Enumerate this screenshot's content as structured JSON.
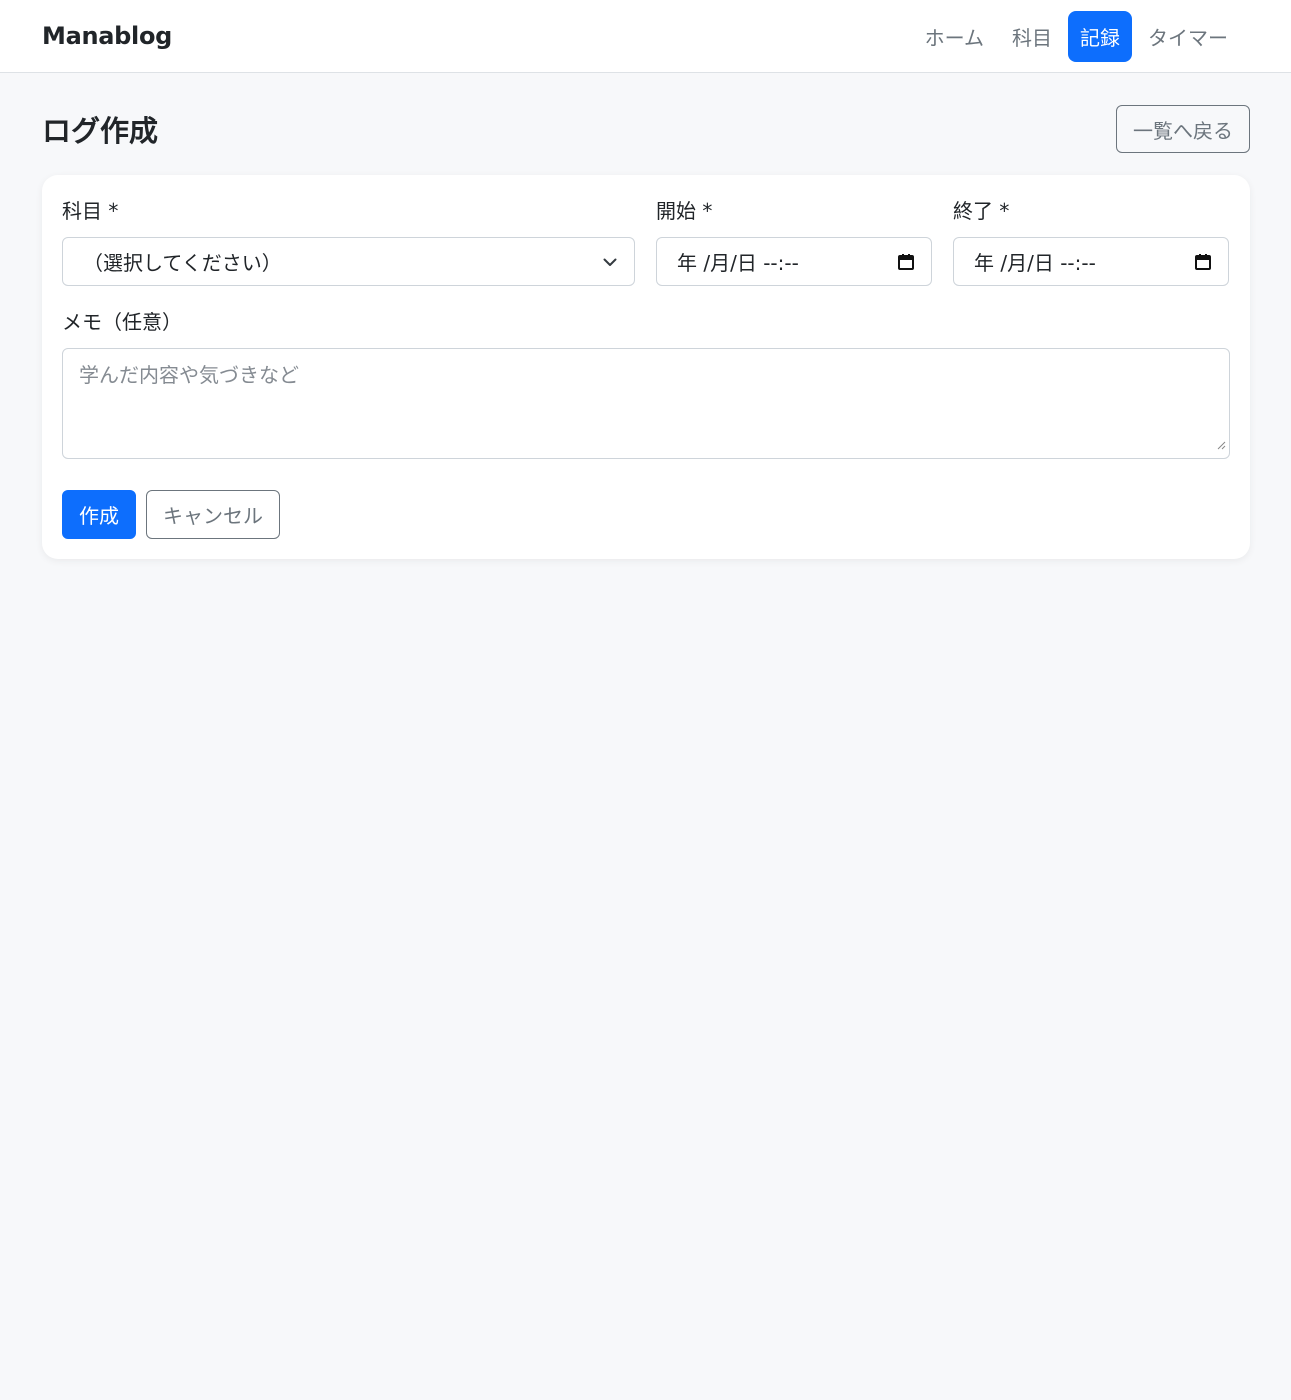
{
  "app": {
    "brand": "Manablog"
  },
  "nav": {
    "items": [
      {
        "label": "ホーム",
        "active": false
      },
      {
        "label": "科目",
        "active": false
      },
      {
        "label": "記録",
        "active": true
      },
      {
        "label": "タイマー",
        "active": false
      }
    ]
  },
  "page": {
    "title": "ログ作成",
    "back_label": "一覧へ戻る"
  },
  "form": {
    "subject": {
      "label": "科目 *",
      "value": "（選択してください）",
      "icon": "chevron-down-icon"
    },
    "start": {
      "label": "開始 *",
      "value": "年 /月/日 --:--",
      "icon": "calendar-icon"
    },
    "end": {
      "label": "終了 *",
      "value": "年 /月/日 --:--",
      "icon": "calendar-icon"
    },
    "memo": {
      "label": "メモ（任意）",
      "placeholder": "学んだ内容や気づきなど"
    },
    "submit_label": "作成",
    "cancel_label": "キャンセル"
  },
  "colors": {
    "primary": "#0d6efd",
    "muted": "#6c757d",
    "background": "#f7f8fa"
  }
}
